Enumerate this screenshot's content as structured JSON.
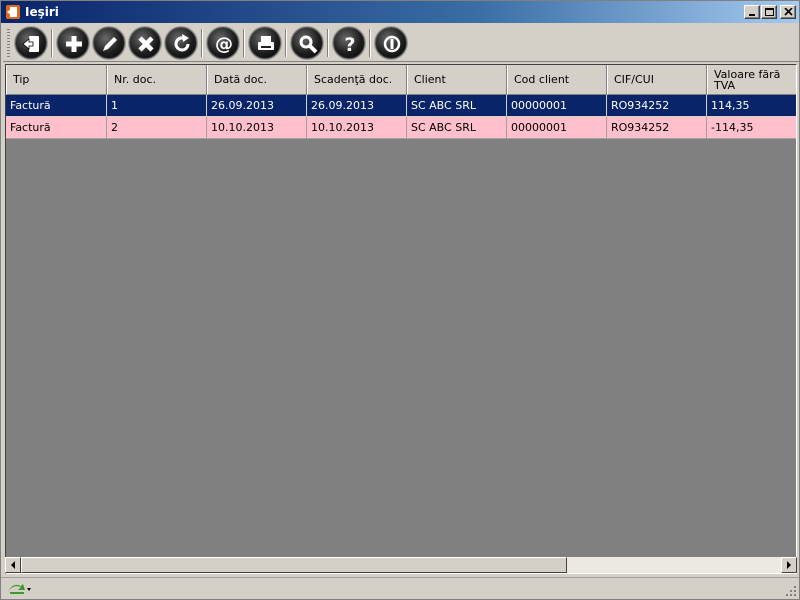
{
  "window": {
    "title": "Ieşiri",
    "controls": [
      "minimize",
      "maximize",
      "close"
    ]
  },
  "toolbar": {
    "buttons": [
      {
        "name": "exit-button",
        "icon": "exit-icon"
      },
      {
        "name": "add-button",
        "icon": "plus-icon"
      },
      {
        "name": "edit-button",
        "icon": "pencil-icon"
      },
      {
        "name": "delete-button",
        "icon": "x-icon"
      },
      {
        "name": "refresh-button",
        "icon": "refresh-icon"
      },
      {
        "name": "email-button",
        "icon": "at-icon"
      },
      {
        "name": "print-button",
        "icon": "printer-icon"
      },
      {
        "name": "search-button",
        "icon": "magnifier-icon"
      },
      {
        "name": "help-button",
        "icon": "question-icon"
      },
      {
        "name": "info-button",
        "icon": "info-icon"
      }
    ]
  },
  "grid": {
    "columns": [
      "Tip",
      "Nr. doc.",
      "Dată doc.",
      "Scadenţă doc.",
      "Client",
      "Cod client",
      "CIF/CUI",
      "Valoare fără TVA"
    ],
    "rows": [
      {
        "cells": [
          "Factură",
          "1",
          "26.09.2013",
          "26.09.2013",
          "SC ABC SRL",
          "00000001",
          "RO934252",
          "114,35"
        ],
        "state": "selected"
      },
      {
        "cells": [
          "Factură",
          "2",
          "10.10.2013",
          "10.10.2013",
          "SC ABC SRL",
          "00000001",
          "RO934252",
          "-114,35"
        ],
        "state": "highlight"
      }
    ]
  },
  "colors": {
    "selected_row": "#0a246a",
    "highlight_row": "#ffc0cb",
    "grid_background": "#808080",
    "titlebar": "#0a246a"
  }
}
